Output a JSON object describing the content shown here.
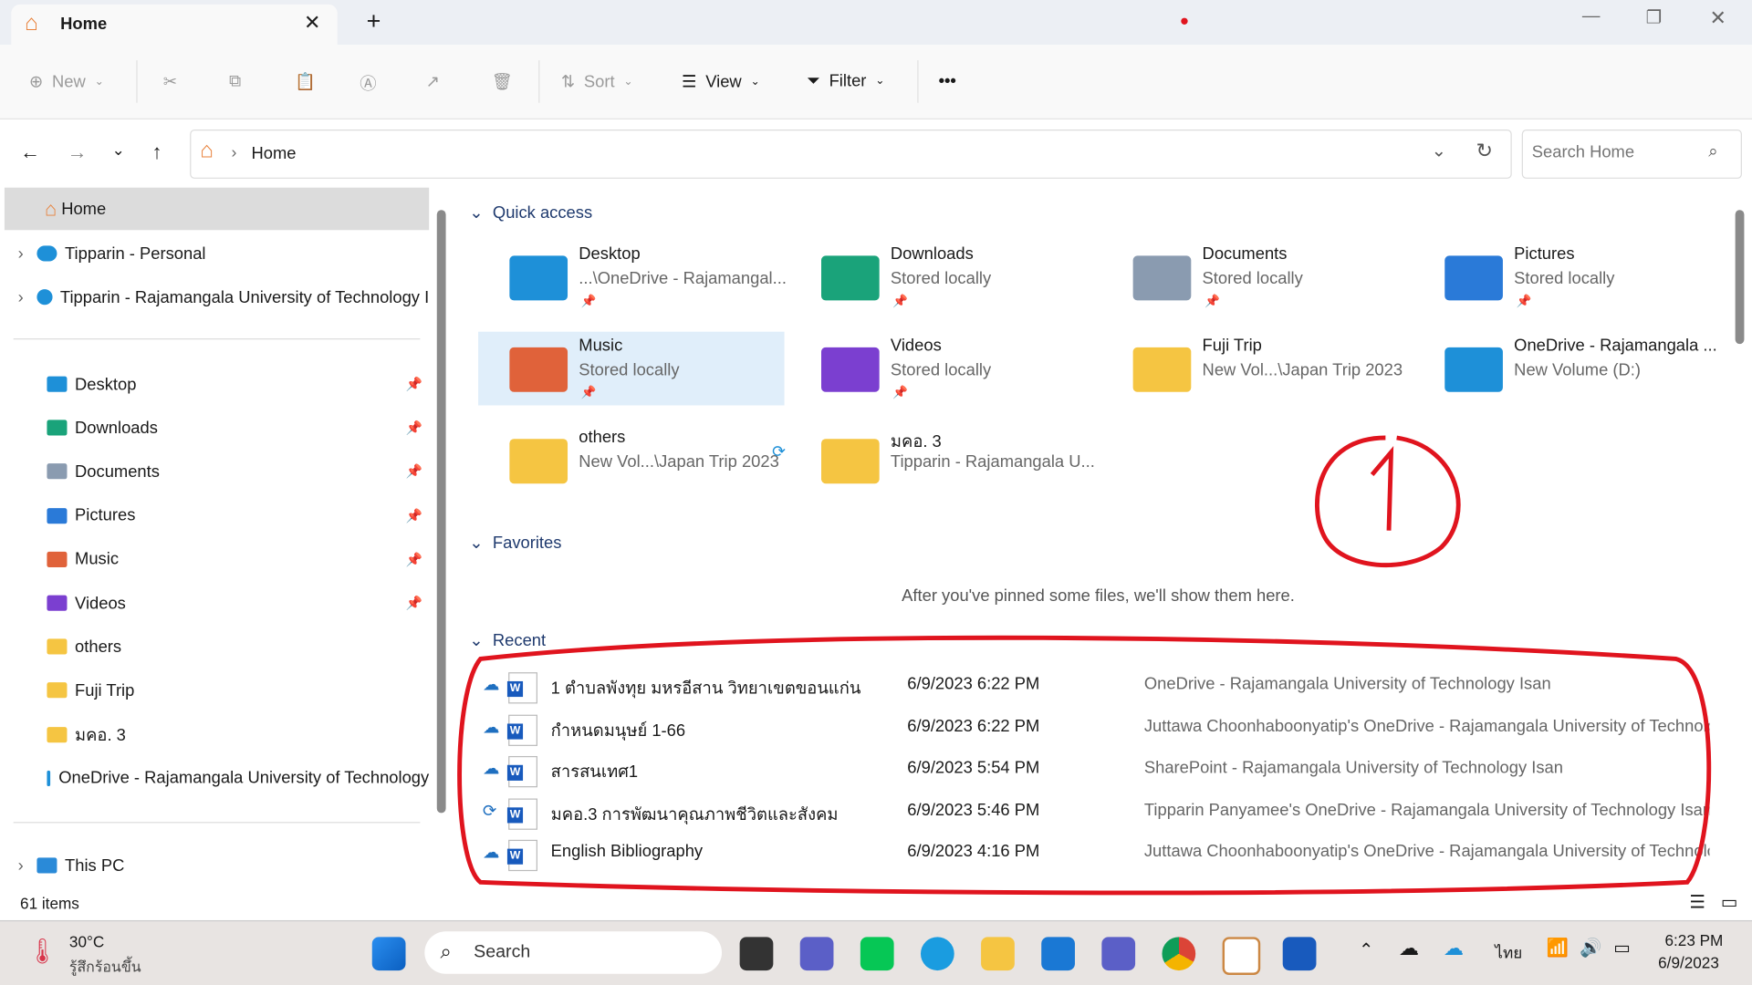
{
  "window": {
    "tab_title": "Home",
    "new_tab": "+"
  },
  "toolbar": {
    "new": "New",
    "sort": "Sort",
    "view": "View",
    "filter": "Filter",
    "more": "•••"
  },
  "address": {
    "crumb": "Home",
    "search_placeholder": "Search Home"
  },
  "sidebar": {
    "home": "Home",
    "top": [
      {
        "label": "Tipparin - Personal"
      },
      {
        "label": "Tipparin - Rajamangala University of Technology I"
      }
    ],
    "pinned": [
      {
        "label": "Desktop",
        "color": "#1e90d8"
      },
      {
        "label": "Downloads",
        "color": "#1aa37a"
      },
      {
        "label": "Documents",
        "color": "#8a9bb0"
      },
      {
        "label": "Pictures",
        "color": "#2a7ad8"
      },
      {
        "label": "Music",
        "color": "#e0623a"
      },
      {
        "label": "Videos",
        "color": "#7b3fd0"
      },
      {
        "label": "others",
        "color": "#f5c542"
      },
      {
        "label": "Fuji Trip",
        "color": "#f5c542"
      },
      {
        "label": "มคอ. 3",
        "color": "#f5c542"
      },
      {
        "label": "OneDrive - Rajamangala University of Technology",
        "color": "#1e90d8"
      }
    ],
    "this_pc": "This PC"
  },
  "status": {
    "items": "61 items"
  },
  "quick_access": {
    "title": "Quick access",
    "items": [
      {
        "name": "Desktop",
        "sub": "...\\OneDrive - Rajamangal...",
        "pinned": true,
        "color": "#1e90d8"
      },
      {
        "name": "Downloads",
        "sub": "Stored locally",
        "pinned": true,
        "color": "#1aa37a"
      },
      {
        "name": "Documents",
        "sub": "Stored locally",
        "pinned": true,
        "color": "#8a9bb0"
      },
      {
        "name": "Pictures",
        "sub": "Stored locally",
        "pinned": true,
        "color": "#2a7ad8"
      },
      {
        "name": "Music",
        "sub": "Stored locally",
        "pinned": true,
        "color": "#e0623a"
      },
      {
        "name": "Videos",
        "sub": "Stored locally",
        "pinned": true,
        "color": "#7b3fd0"
      },
      {
        "name": "Fuji Trip",
        "sub": "New Vol...\\Japan Trip 2023",
        "pinned": false,
        "color": "#f5c542"
      },
      {
        "name": "OneDrive - Rajamangala ...",
        "sub": "New Volume (D:)",
        "pinned": false,
        "color": "#1e90d8"
      },
      {
        "name": "others",
        "sub": "New Vol...\\Japan Trip 2023",
        "pinned": false,
        "color": "#f5c542"
      },
      {
        "name": "มคอ. 3",
        "sub": "Tipparin - Rajamangala U...",
        "pinned": false,
        "color": "#f5c542"
      }
    ]
  },
  "favorites": {
    "title": "Favorites",
    "empty": "After you've pinned some files, we'll show them here."
  },
  "recent": {
    "title": "Recent",
    "items": [
      {
        "name": "1 ตำบลพังทุย มหรอีสาน วิทยาเขตขอนแก่น",
        "date": "6/9/2023 6:22 PM",
        "location": "OneDrive - Rajamangala University of Technology Isan",
        "status": "cloud"
      },
      {
        "name": "กำหนดมนุษย์ 1-66",
        "date": "6/9/2023 6:22 PM",
        "location": "Juttawa Choonhaboonyatip's OneDrive - Rajamangala University of Technolo...",
        "status": "cloud"
      },
      {
        "name": "สารสนเทศ1",
        "date": "6/9/2023 5:54 PM",
        "location": "SharePoint - Rajamangala University of Technology Isan",
        "status": "cloud"
      },
      {
        "name": "มคอ.3 การพัฒนาคุณภาพชีวิตและสังคม",
        "date": "6/9/2023 5:46 PM",
        "location": "Tipparin Panyamee's OneDrive - Rajamangala University of Technology Isan",
        "status": "sync"
      },
      {
        "name": "English Bibliography",
        "date": "6/9/2023 4:16 PM",
        "location": "Juttawa Choonhaboonyatip's OneDrive - Rajamangala University of Technolo...",
        "status": "cloud"
      }
    ]
  },
  "annotation": {
    "label": "1",
    "color": "#e0141e"
  },
  "taskbar": {
    "temp": "30°C",
    "weather": "รู้สึกร้อนขึ้น",
    "search": "Search",
    "lang": "ไทย",
    "time": "6:23 PM",
    "date": "6/9/2023"
  }
}
